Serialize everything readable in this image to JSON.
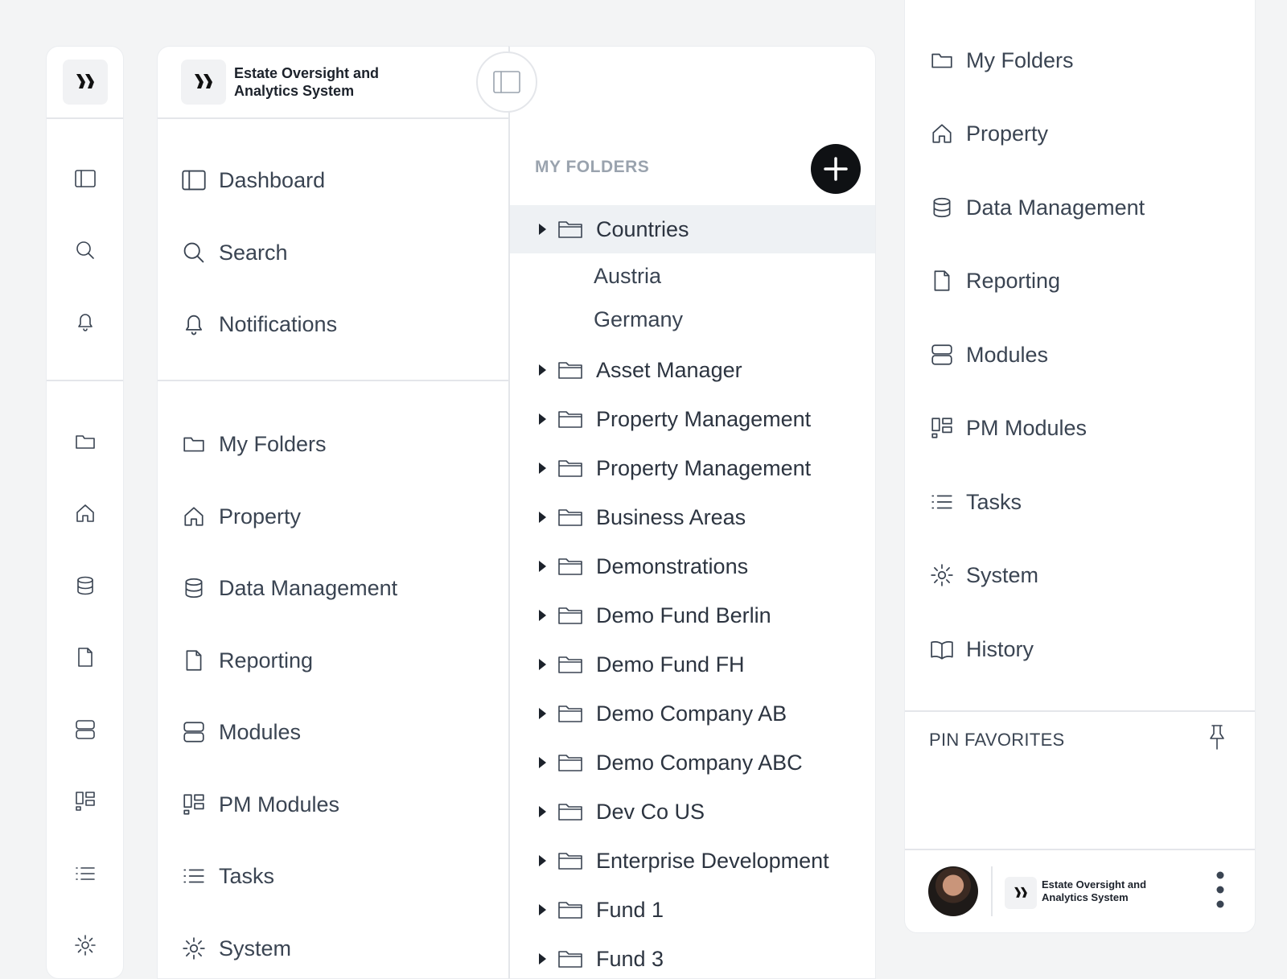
{
  "app": {
    "name": "Estate Oversight and Analytics System"
  },
  "primary_nav": [
    {
      "label": "Dashboard",
      "icon": "sidebar-panel-icon"
    },
    {
      "label": "Search",
      "icon": "search-icon"
    },
    {
      "label": "Notifications",
      "icon": "bell-icon"
    }
  ],
  "secondary_nav": [
    {
      "label": "My Folders",
      "icon": "folder-icon"
    },
    {
      "label": "Property",
      "icon": "home-icon"
    },
    {
      "label": "Data Management",
      "icon": "database-icon"
    },
    {
      "label": "Reporting",
      "icon": "document-icon"
    },
    {
      "label": "Modules",
      "icon": "modules-icon"
    },
    {
      "label": "PM Modules",
      "icon": "pm-modules-icon"
    },
    {
      "label": "Tasks",
      "icon": "list-icon"
    },
    {
      "label": "System",
      "icon": "gear-icon"
    }
  ],
  "folders": {
    "header": "MY FOLDERS",
    "items": [
      {
        "label": "Countries",
        "selected": true,
        "children": [
          "Austria",
          "Germany"
        ]
      },
      {
        "label": "Asset Manager"
      },
      {
        "label": "Property Management"
      },
      {
        "label": "Property Management"
      },
      {
        "label": "Business Areas"
      },
      {
        "label": "Demonstrations"
      },
      {
        "label": "Demo Fund Berlin"
      },
      {
        "label": "Demo Fund FH"
      },
      {
        "label": "Demo Company AB"
      },
      {
        "label": "Demo Company ABC"
      },
      {
        "label": "Dev Co US"
      },
      {
        "label": "Enterprise Development"
      },
      {
        "label": "Fund 1"
      },
      {
        "label": "Fund 3"
      }
    ]
  },
  "right_nav": [
    {
      "label": "My Folders",
      "icon": "folder-icon"
    },
    {
      "label": "Property",
      "icon": "home-icon"
    },
    {
      "label": "Data Management",
      "icon": "database-icon"
    },
    {
      "label": "Reporting",
      "icon": "document-icon"
    },
    {
      "label": "Modules",
      "icon": "modules-icon"
    },
    {
      "label": "PM Modules",
      "icon": "pm-modules-icon"
    },
    {
      "label": "Tasks",
      "icon": "list-icon"
    },
    {
      "label": "System",
      "icon": "gear-icon"
    },
    {
      "label": "History",
      "icon": "book-icon"
    }
  ],
  "favorites": {
    "header": "PIN FAVORITES"
  },
  "footer": {
    "app_name": "Estate Oversight and Analytics System"
  },
  "colors": {
    "accent": "#0f1114",
    "selected_row": "#eef1f4",
    "muted_header": "#9aa3ae"
  }
}
